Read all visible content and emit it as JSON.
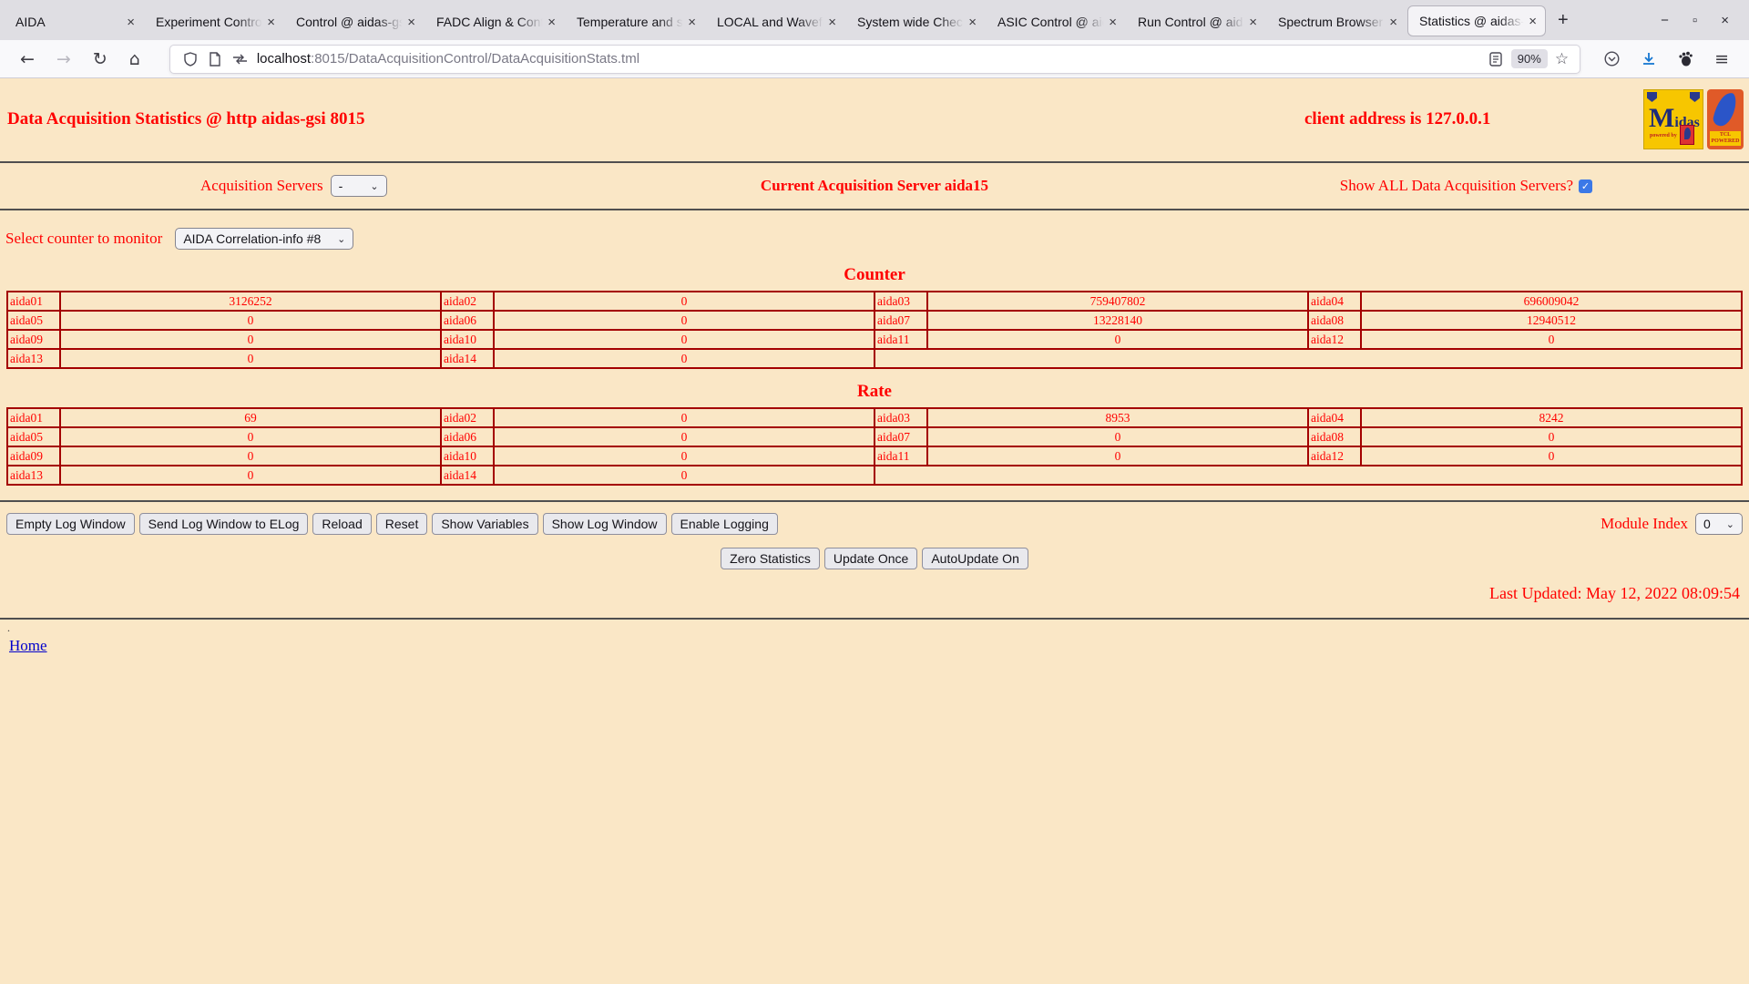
{
  "browser": {
    "tabs": [
      {
        "label": "AIDA",
        "active": false
      },
      {
        "label": "Experiment Control",
        "active": false
      },
      {
        "label": "Control @ aidas-gs",
        "active": false
      },
      {
        "label": "FADC Align & Cont",
        "active": false
      },
      {
        "label": "Temperature and st",
        "active": false
      },
      {
        "label": "LOCAL and Wavefo",
        "active": false
      },
      {
        "label": "System wide Check",
        "active": false
      },
      {
        "label": "ASIC Control @ aid",
        "active": false
      },
      {
        "label": "Run Control @ aida",
        "active": false
      },
      {
        "label": "Spectrum Browser",
        "active": false
      },
      {
        "label": "Statistics @ aidas-g",
        "active": true
      }
    ],
    "tab_close_glyph": "×",
    "new_tab_glyph": "+",
    "window_controls": {
      "minimize": "−",
      "maximize": "▫",
      "close": "×"
    },
    "nav": {
      "back": "←",
      "forward": "→",
      "reload": "↻",
      "home": "⌂"
    },
    "urlbar": {
      "host": "localhost",
      "path": ":8015/DataAcquisitionControl/DataAcquisitionStats.tml",
      "zoom_level": "90%",
      "star_glyph": "☆",
      "menu_glyph": "≡"
    }
  },
  "page": {
    "title": "Data Acquisition Statistics @ http aidas-gsi 8015",
    "client_address": "client address is 127.0.0.1",
    "acq_servers_label": "Acquisition Servers",
    "acq_servers_value": "-",
    "current_server": "Current Acquisition Server aida15",
    "show_all_label": "Show ALL Data Acquisition Servers?",
    "show_all_checked": "✓",
    "select_counter_label": "Select counter to monitor",
    "select_counter_value": "AIDA Correlation-info #8",
    "counter_heading": "Counter",
    "rate_heading": "Rate",
    "counter_table": {
      "rows": [
        [
          [
            "aida01",
            "3126252"
          ],
          [
            "aida02",
            "0"
          ],
          [
            "aida03",
            "759407802"
          ],
          [
            "aida04",
            "696009042"
          ]
        ],
        [
          [
            "aida05",
            "0"
          ],
          [
            "aida06",
            "0"
          ],
          [
            "aida07",
            "13228140"
          ],
          [
            "aida08",
            "12940512"
          ]
        ],
        [
          [
            "aida09",
            "0"
          ],
          [
            "aida10",
            "0"
          ],
          [
            "aida11",
            "0"
          ],
          [
            "aida12",
            "0"
          ]
        ],
        [
          [
            "aida13",
            "0"
          ],
          [
            "aida14",
            "0"
          ]
        ]
      ]
    },
    "rate_table": {
      "rows": [
        [
          [
            "aida01",
            "69"
          ],
          [
            "aida02",
            "0"
          ],
          [
            "aida03",
            "8953"
          ],
          [
            "aida04",
            "8242"
          ]
        ],
        [
          [
            "aida05",
            "0"
          ],
          [
            "aida06",
            "0"
          ],
          [
            "aida07",
            "0"
          ],
          [
            "aida08",
            "0"
          ]
        ],
        [
          [
            "aida09",
            "0"
          ],
          [
            "aida10",
            "0"
          ],
          [
            "aida11",
            "0"
          ],
          [
            "aida12",
            "0"
          ]
        ],
        [
          [
            "aida13",
            "0"
          ],
          [
            "aida14",
            "0"
          ]
        ]
      ]
    },
    "log_buttons": [
      "Empty Log Window",
      "Send Log Window to ELog",
      "Reload",
      "Reset",
      "Show Variables",
      "Show Log Window",
      "Enable Logging"
    ],
    "module_index_label": "Module Index",
    "module_index_value": "0",
    "action_buttons": [
      "Zero Statistics",
      "Update Once",
      "AutoUpdate On"
    ],
    "last_updated": "Last Updated: May 12, 2022 08:09:54",
    "footer_dot": ".",
    "home_link": "Home",
    "logos": {
      "midas_big": "M",
      "midas_small": "idas",
      "midas_sub": "powered by",
      "tcl_line1": "TCL",
      "tcl_line2": "POWERED"
    }
  },
  "colors": {
    "page_bg": "#fae7c6",
    "accent_red": "#ff0000",
    "table_border": "#a40000",
    "link_blue": "#0000cc",
    "download_blue": "#1677d1",
    "checkbox_blue": "#3b78e7"
  }
}
